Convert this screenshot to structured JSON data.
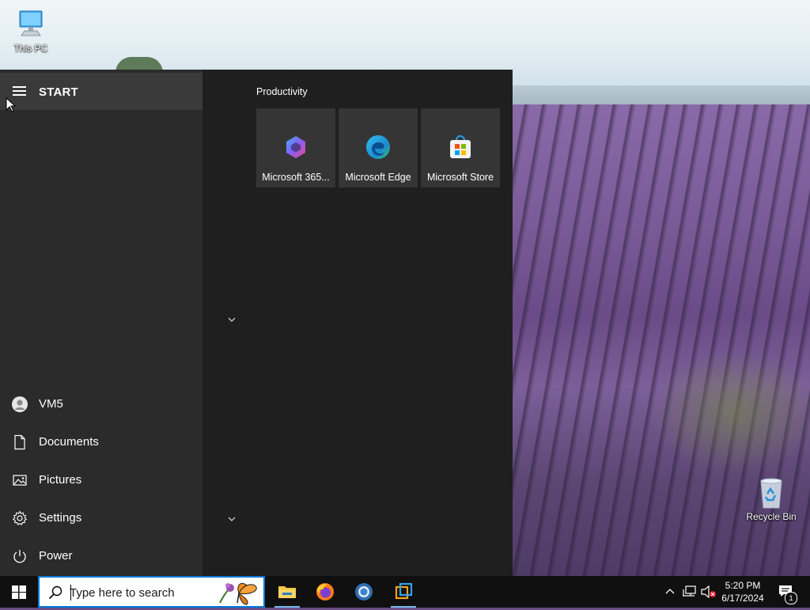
{
  "desktop": {
    "icons": [
      {
        "label": "This PC",
        "icon": "computer-icon"
      },
      {
        "label": "Recycle Bin",
        "icon": "recycle-bin-icon"
      }
    ]
  },
  "start_menu": {
    "header_label": "START",
    "side_items": [
      {
        "label": "VM5",
        "icon": "user-avatar-icon"
      },
      {
        "label": "Documents",
        "icon": "document-icon"
      },
      {
        "label": "Pictures",
        "icon": "pictures-icon"
      },
      {
        "label": "Settings",
        "icon": "gear-icon"
      },
      {
        "label": "Power",
        "icon": "power-icon"
      }
    ],
    "group": {
      "title": "Productivity",
      "tiles": [
        {
          "label": "Microsoft 365...",
          "icon": "microsoft-365-icon"
        },
        {
          "label": "Microsoft Edge",
          "icon": "edge-icon"
        },
        {
          "label": "Microsoft Store",
          "icon": "store-icon"
        }
      ]
    }
  },
  "taskbar": {
    "search_placeholder": "Type here to search",
    "pinned": [
      {
        "name": "File Explorer",
        "icon": "folder-icon"
      },
      {
        "name": "Firefox",
        "icon": "firefox-icon"
      },
      {
        "name": "Chrome",
        "icon": "chrome-icon"
      },
      {
        "name": "VirtualBox",
        "icon": "virtualbox-icon"
      }
    ],
    "clock": {
      "time": "5:20 PM",
      "date": "6/17/2024"
    },
    "notification_count": "1"
  },
  "colors": {
    "accent": "#0078d7",
    "start_bg": "#1f1f1f",
    "start_left_bg": "#2b2b2b",
    "tile_bg": "#353535",
    "taskbar_bg": "#101010"
  }
}
